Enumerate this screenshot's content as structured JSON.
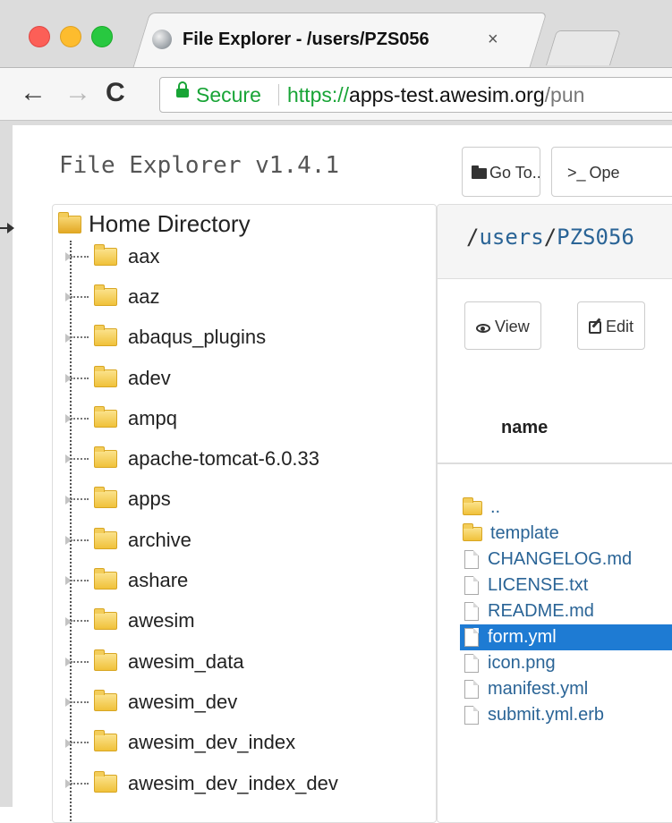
{
  "browser": {
    "tab_title": "File Explorer - /users/PZS056",
    "tab_close": "×",
    "secure_label": "Secure",
    "url_scheme": "https://",
    "url_host": "apps-test.awesim.org",
    "url_path": "/pun",
    "back_glyph": "←",
    "forward_glyph": "→",
    "reload_glyph": "C"
  },
  "app": {
    "title": "File Explorer v1.4.1",
    "goto_label": "Go To...",
    "open_terminal_prefix": ">_",
    "open_terminal_label": "Ope"
  },
  "tree": {
    "root_label": "Home Directory",
    "items": [
      {
        "label": "aax"
      },
      {
        "label": "aaz"
      },
      {
        "label": "abaqus_plugins"
      },
      {
        "label": "adev"
      },
      {
        "label": "ampq"
      },
      {
        "label": "apache-tomcat-6.0.33"
      },
      {
        "label": "apps"
      },
      {
        "label": "archive"
      },
      {
        "label": "ashare"
      },
      {
        "label": "awesim"
      },
      {
        "label": "awesim_data"
      },
      {
        "label": "awesim_dev"
      },
      {
        "label": "awesim_dev_index"
      },
      {
        "label": "awesim_dev_index_dev"
      }
    ]
  },
  "main": {
    "path_segments": [
      "users",
      "PZS056"
    ],
    "path_sep": "/",
    "view_label": "View",
    "edit_label": "Edit",
    "column_name": "name",
    "files": [
      {
        "name": "..",
        "type": "folder",
        "selected": false
      },
      {
        "name": "template",
        "type": "folder",
        "selected": false
      },
      {
        "name": "CHANGELOG.md",
        "type": "file",
        "selected": false
      },
      {
        "name": "LICENSE.txt",
        "type": "file",
        "selected": false
      },
      {
        "name": "README.md",
        "type": "file",
        "selected": false
      },
      {
        "name": "form.yml",
        "type": "file",
        "selected": true
      },
      {
        "name": "icon.png",
        "type": "file",
        "selected": false
      },
      {
        "name": "manifest.yml",
        "type": "file",
        "selected": false
      },
      {
        "name": "submit.yml.erb",
        "type": "file",
        "selected": false
      }
    ]
  },
  "colors": {
    "link": "#2a6496",
    "selected_row": "#1e7bd3",
    "secure_green": "#18a436"
  }
}
